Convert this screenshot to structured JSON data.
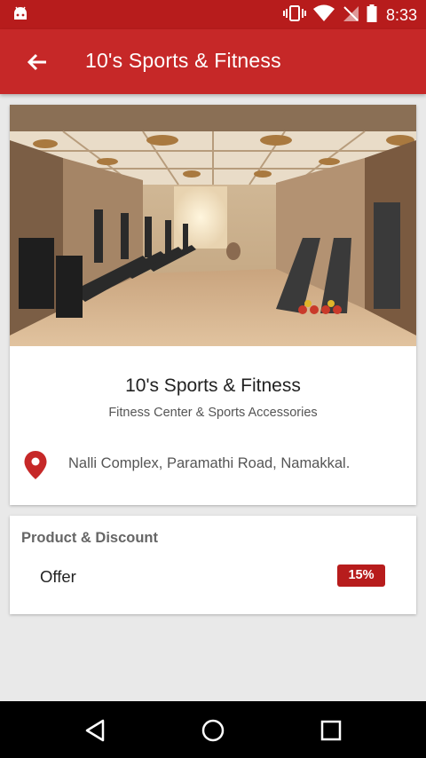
{
  "status_bar": {
    "time": "8:33",
    "icons": [
      "android-debug-icon",
      "vibrate-icon",
      "wifi-icon",
      "no-sim-icon",
      "battery-icon"
    ]
  },
  "app_bar": {
    "title": "10's Sports & Fitness",
    "back_icon": "arrow-back-icon"
  },
  "business": {
    "name": "10's Sports & Fitness",
    "category": "Fitness Center & Sports Accessories",
    "address": "Nalli Complex, Paramathi Road, Namakkal.",
    "location_icon": "location-pin-icon"
  },
  "offers": {
    "section_title": "Product & Discount",
    "items": [
      {
        "label": "Offer",
        "discount": "15%"
      }
    ]
  },
  "nav_bar": {
    "buttons": [
      "back-triangle-icon",
      "home-circle-icon",
      "recents-square-icon"
    ]
  },
  "colors": {
    "primary": "#c62828",
    "primary_dark": "#b71c1c",
    "badge": "#b71c1c",
    "background": "#e9e9e9"
  }
}
